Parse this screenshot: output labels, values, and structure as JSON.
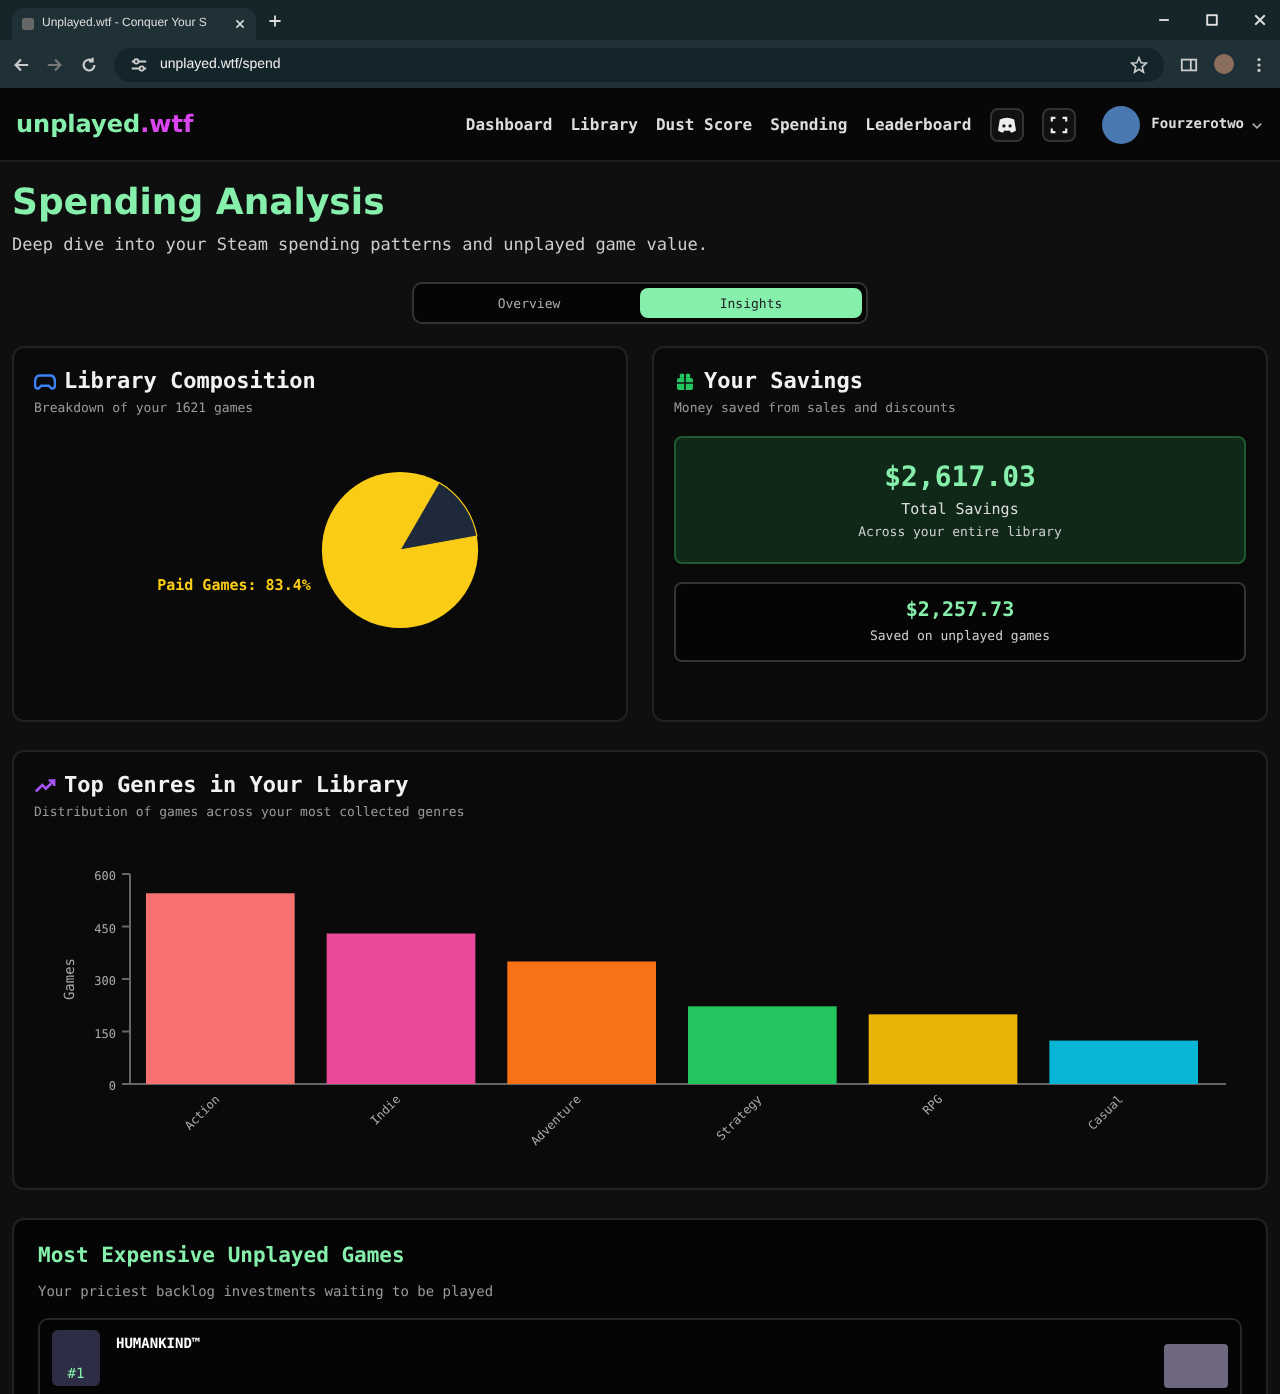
{
  "browser": {
    "tab_title": "Unplayed.wtf - Conquer Your S",
    "url": "unplayed.wtf/spend"
  },
  "nav": {
    "logo": {
      "main": "unplayed",
      "accent": ".wtf"
    },
    "links": [
      "Dashboard",
      "Library",
      "Dust Score",
      "Spending",
      "Leaderboard"
    ],
    "user": "Fourzerotwo"
  },
  "page": {
    "title": "Spending Analysis",
    "subtitle": "Deep dive into your Steam spending patterns and unplayed game value."
  },
  "view_tabs": [
    {
      "label": "Overview",
      "selected": false
    },
    {
      "label": "Insights",
      "selected": true
    }
  ],
  "composition": {
    "title": "Library Composition",
    "subtitle": "Breakdown of your 1621 games",
    "pie_label": "Paid Games: 83.4%"
  },
  "savings": {
    "title": "Your Savings",
    "subtitle": "Money saved from sales and discounts",
    "total": {
      "amount": "$2,617.03",
      "label": "Total Savings",
      "note": "Across your entire library"
    },
    "unplayed": {
      "amount": "$2,257.73",
      "label": "Saved on unplayed games"
    }
  },
  "genres": {
    "title": "Top Genres in Your Library",
    "subtitle": "Distribution of games across your most collected genres",
    "chart_data": {
      "type": "bar",
      "ylabel": "Games",
      "categories": [
        "Action",
        "Indie",
        "Adventure",
        "Strategy",
        "RPG",
        "Casual"
      ],
      "series": [
        {
          "color": "#f87171",
          "values": [
            545,
            null,
            null,
            null,
            null,
            null
          ]
        },
        {
          "color": "#ec4899",
          "values": [
            null,
            430,
            null,
            null,
            null,
            null
          ]
        },
        {
          "color": "#f97316",
          "values": [
            null,
            null,
            350,
            null,
            null,
            null
          ]
        },
        {
          "color": "#22c55e",
          "values": [
            null,
            null,
            null,
            222,
            null,
            null
          ]
        },
        {
          "color": "#eab308",
          "values": [
            null,
            null,
            null,
            null,
            199,
            null
          ]
        },
        {
          "color": "#06b6d4",
          "values": [
            null,
            null,
            null,
            null,
            null,
            124
          ]
        }
      ],
      "ylim": [
        0,
        600
      ],
      "yticks": [
        0,
        150,
        300,
        450,
        600
      ]
    }
  },
  "expensive": {
    "title": "Most Expensive Unplayed Games",
    "subtitle": "Your priciest backlog investments waiting to be played",
    "games": [
      {
        "rank": "#1",
        "name": "HUMANKIND™"
      }
    ]
  }
}
